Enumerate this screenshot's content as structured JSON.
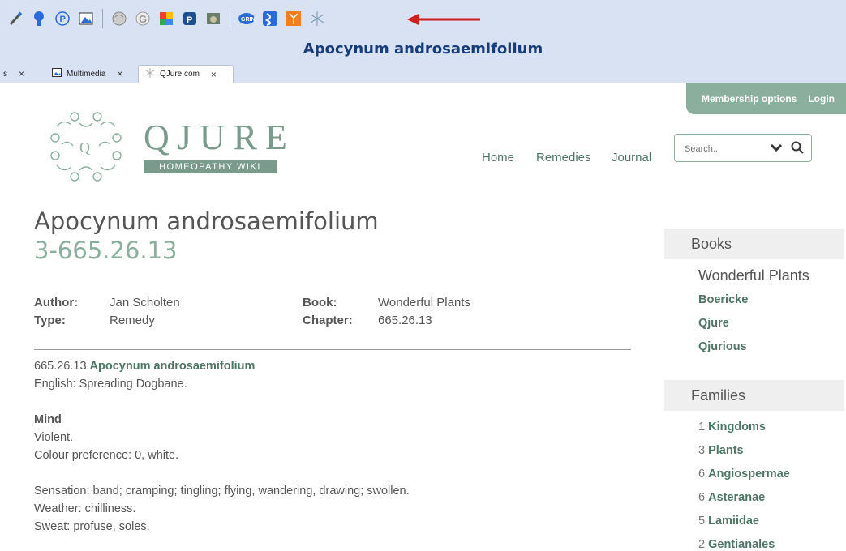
{
  "toolbar": {
    "icons": [
      "brush-icon",
      "tree-icon",
      "p-circle-icon",
      "image-icon",
      "wikipedia-icon",
      "google-icon",
      "puzzle-icon",
      "p-square-icon",
      "rock-icon",
      "grin-icon",
      "dna-icon",
      "fractal-icon",
      "snowflake-icon"
    ],
    "window_title": "Apocynum androsaemifolium",
    "tabs": [
      {
        "label": "s",
        "close": "×"
      },
      {
        "label": "Multimedia",
        "close": "×"
      },
      {
        "label": "QJure.com",
        "close": "×"
      }
    ],
    "arrow_color": "#cc1f1f"
  },
  "site": {
    "membership": "Membership options",
    "login": "Login",
    "logo_name": "QJURE",
    "logo_sub": "HOMEOPATHY WIKI",
    "nav": [
      "Home",
      "Remedies",
      "Journal"
    ],
    "search_placeholder": "Search...",
    "accent": "#8aaf9d"
  },
  "main": {
    "title": "Apocynum androsaemifolium",
    "subtitle": "3-665.26.13",
    "author_label": "Author:",
    "author": "Jan Scholten",
    "type_label": "Type:",
    "type": "Remedy",
    "book_label": "Book:",
    "book": "Wonderful Plants",
    "chapter_label": "Chapter:",
    "chapter": "665.26.13",
    "code": "665.26.13",
    "latin": "Apocynum androsaemifolium",
    "english": "English: Spreading Dogbane.",
    "mind_heading": "Mind",
    "lines1": [
      "Violent.",
      "Colour preference: 0, white."
    ],
    "lines2": [
      "Sensation: band; cramping; tingling; flying, wandering, drawing; swollen.",
      "Weather: chilliness.",
      "Sweat: profuse, soles."
    ]
  },
  "sidebar": {
    "books_heading": "Books",
    "book_main": "Wonderful Plants",
    "book_links": [
      "Boericke",
      "Qjure",
      "Qjurious"
    ],
    "families_heading": "Families",
    "families": [
      {
        "num": "1",
        "name": "Kingdoms"
      },
      {
        "num": "3",
        "name": "Plants"
      },
      {
        "num": "6",
        "name": "Angiospermae"
      },
      {
        "num": "6",
        "name": "Asteranae"
      },
      {
        "num": "5",
        "name": "Lamiidae"
      },
      {
        "num": "2",
        "name": "Gentianales"
      }
    ]
  }
}
